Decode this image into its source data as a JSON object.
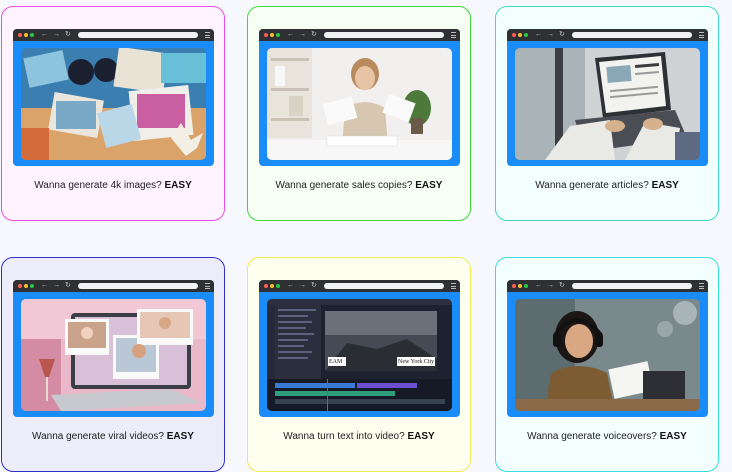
{
  "cards": [
    {
      "prefix": "Wanna generate 4k images?",
      "emphasis": "EASY",
      "border": "#e84de6",
      "bg": "#fff3ff"
    },
    {
      "prefix": "Wanna generate sales copies?",
      "emphasis": "EASY",
      "border": "#3ed83a",
      "bg": "#f6fff4"
    },
    {
      "prefix": "Wanna generate articles?",
      "emphasis": "EASY",
      "border": "#3ed8c4",
      "bg": "#f3fffc"
    },
    {
      "prefix": "Wanna generate viral videos?",
      "emphasis": "EASY",
      "border": "#3030c8",
      "bg": "#ececfa"
    },
    {
      "prefix": "Wanna turn text into video?",
      "emphasis": "EASY",
      "border": "#f0ea50",
      "bg": "#fffff0"
    },
    {
      "prefix": "Wanna generate voiceovers?",
      "emphasis": "EASY",
      "border": "#36dfe0",
      "bg": "#f2fffe"
    }
  ],
  "video_editor": {
    "overlay_left": "EAM",
    "overlay_right": "New York City"
  },
  "colors": {
    "browser_frame": "#1a8cf7",
    "browser_topbar": "#2e3033"
  }
}
